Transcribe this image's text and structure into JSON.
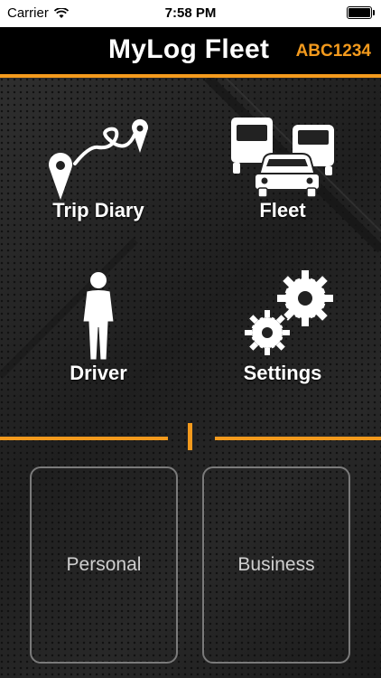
{
  "status_bar": {
    "carrier": "Carrier",
    "time": "7:58 PM"
  },
  "header": {
    "title": "MyLog Fleet",
    "vehicle_plate": "ABC1234"
  },
  "menu": {
    "trip_diary": "Trip Diary",
    "fleet": "Fleet",
    "driver": "Driver",
    "settings": "Settings"
  },
  "modes": {
    "personal": "Personal",
    "business": "Business"
  },
  "colors": {
    "accent": "#f39a1d",
    "background": "#232323",
    "header": "#000000"
  }
}
